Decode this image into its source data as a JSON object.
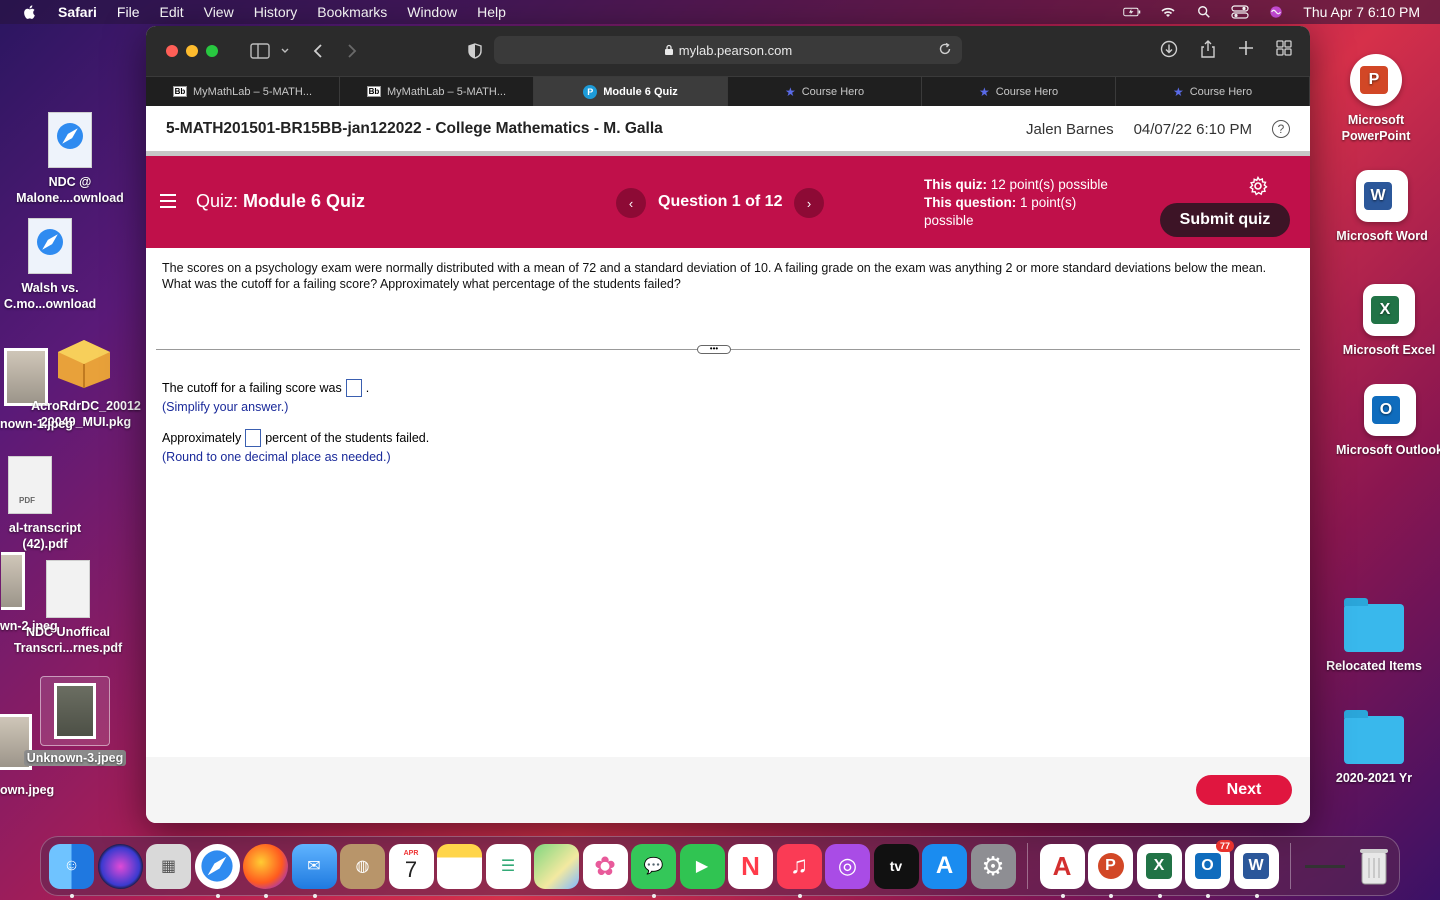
{
  "menubar": {
    "app": "Safari",
    "items": [
      "File",
      "Edit",
      "View",
      "History",
      "Bookmarks",
      "Window",
      "Help"
    ],
    "clock": "Thu Apr 7  6:10 PM"
  },
  "desktop": {
    "left_icons": [
      {
        "label": "NDC @\nMalone....ownload"
      },
      {
        "label": "Walsh vs.\nC.mo...ownload"
      },
      {
        "label": "AcroRdrDC_20012\n20049_MUI.pkg"
      },
      {
        "label": "nown-1.jpeg"
      },
      {
        "label": "al-transcript\n(42).pdf"
      },
      {
        "label": "wn-2.jpeg"
      },
      {
        "label": "NDC Unoffical\nTranscri...rnes.pdf"
      },
      {
        "label": "Unknown-3.jpeg"
      },
      {
        "label": "own.jpeg"
      }
    ],
    "right_icons": [
      {
        "label": "Microsoft\nPowerPoint",
        "color": "#d24726",
        "glyph": "P"
      },
      {
        "label": "Microsoft Word",
        "color": "#2b579a",
        "glyph": "W"
      },
      {
        "label": "Microsoft Excel",
        "color": "#217346",
        "glyph": "X"
      },
      {
        "label": "Microsoft Outlook",
        "color": "#0f6cbd",
        "glyph": "O"
      },
      {
        "label": "Relocated Items"
      },
      {
        "label": "2020-2021 Yr"
      }
    ]
  },
  "browser": {
    "url": "mylab.pearson.com",
    "tabs": [
      {
        "label": "MyMathLab – 5-MATH...",
        "icon": "Bb"
      },
      {
        "label": "MyMathLab – 5-MATH...",
        "icon": "Bb"
      },
      {
        "label": "Module 6 Quiz",
        "icon": "P",
        "active": true
      },
      {
        "label": "Course Hero",
        "icon": "★"
      },
      {
        "label": "Course Hero",
        "icon": "★"
      },
      {
        "label": "Course Hero",
        "icon": "★"
      }
    ]
  },
  "course": {
    "title": "5-MATH201501-BR15BB-jan122022 - College Mathematics - M. Galla",
    "student": "Jalen Barnes",
    "datetime": "04/07/22 6:10 PM",
    "help": "?"
  },
  "quiz": {
    "label": "Quiz:",
    "name": "Module 6 Quiz",
    "question_counter": "Question 1 of 12",
    "prev": "‹",
    "next_arrow": "›",
    "this_quiz_label": "This quiz:",
    "this_quiz_value": "12 point(s) possible",
    "this_question_label": "This question:",
    "this_question_value": "1 point(s) possible",
    "submit": "Submit quiz"
  },
  "question": {
    "text": "The scores on a psychology exam were normally distributed with a mean of 72 and a standard deviation of 10. A failing grade on the exam was anything 2 or more standard deviations below the mean. What was the cutoff for a failing score? Approximately what percentage of the students failed?",
    "part1_prefix": "The cutoff for a failing score was",
    "part1_suffix": ".",
    "part1_hint": "(Simplify your answer.)",
    "part2_prefix": "Approximately",
    "part2_suffix": "percent of the students failed.",
    "part2_hint": "(Round to one decimal place as needed.)",
    "divider_handle": "•••"
  },
  "footer": {
    "next": "Next"
  },
  "dock": {
    "apps": [
      {
        "name": "Finder",
        "color": "#3a8ee6",
        "glyph": "☺"
      },
      {
        "name": "Siri",
        "color": "#6a3cc9",
        "glyph": "◉"
      },
      {
        "name": "Launchpad",
        "color": "#c6c6c6",
        "glyph": "▦"
      },
      {
        "name": "Safari",
        "color": "#1e88e5",
        "glyph": "⊙"
      },
      {
        "name": "Firefox",
        "color": "#ff7a18",
        "glyph": "◐"
      },
      {
        "name": "Mail",
        "color": "#3b9bf5",
        "glyph": "✉"
      },
      {
        "name": "Contacts",
        "color": "#b08a5a",
        "glyph": "◍"
      },
      {
        "name": "Calendar",
        "color": "#ffffff",
        "glyph": "7"
      },
      {
        "name": "Notes",
        "color": "#ffd54a",
        "glyph": "≡"
      },
      {
        "name": "Reminders",
        "color": "#ffffff",
        "glyph": "☰"
      },
      {
        "name": "Maps",
        "color": "#5bbf5b",
        "glyph": "⌖"
      },
      {
        "name": "Photos",
        "color": "#ffffff",
        "glyph": "✿"
      },
      {
        "name": "Messages",
        "color": "#34c759",
        "glyph": "✉"
      },
      {
        "name": "FaceTime",
        "color": "#30c452",
        "glyph": "▶"
      },
      {
        "name": "News",
        "color": "#ff3b4a",
        "glyph": "N"
      },
      {
        "name": "Music",
        "color": "#fa3b55",
        "glyph": "♫"
      },
      {
        "name": "Podcasts",
        "color": "#a94ce6",
        "glyph": "◎"
      },
      {
        "name": "TV",
        "color": "#111111",
        "glyph": "tv"
      },
      {
        "name": "App Store",
        "color": "#1a8cf0",
        "glyph": "A"
      },
      {
        "name": "System Preferences",
        "color": "#8e8e93",
        "glyph": "⚙"
      },
      {
        "name": "Acrobat",
        "color": "#d32f2f",
        "glyph": "A"
      },
      {
        "name": "PowerPoint",
        "color": "#d24726",
        "glyph": "P"
      },
      {
        "name": "Excel",
        "color": "#217346",
        "glyph": "X"
      },
      {
        "name": "Outlook",
        "color": "#0f6cbd",
        "glyph": "O",
        "badge": "77"
      },
      {
        "name": "Word",
        "color": "#2b579a",
        "glyph": "W"
      }
    ],
    "trash": "Trash"
  }
}
